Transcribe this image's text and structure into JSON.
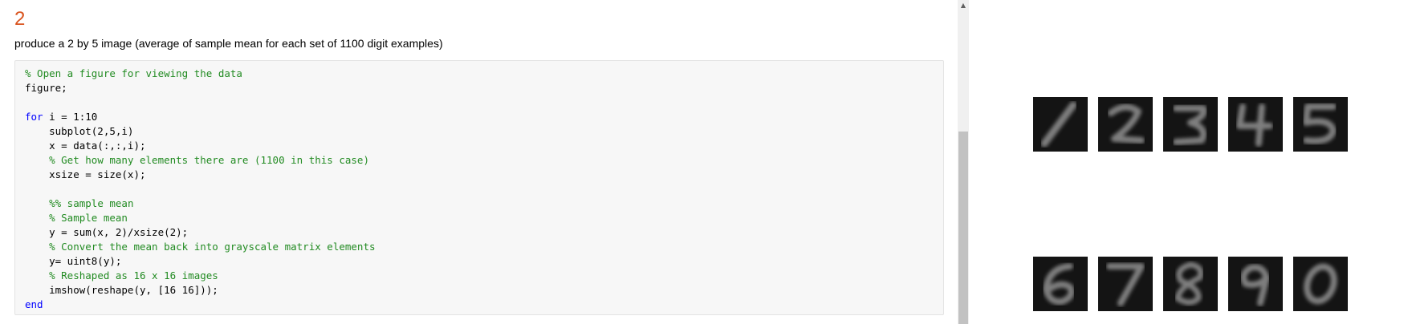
{
  "section": {
    "number": "2",
    "description": "produce a 2 by 5 image (average of sample mean for each set of 1100 digit examples)"
  },
  "code": {
    "lines": [
      [
        {
          "t": "% Open a figure for viewing the data",
          "c": "comment"
        }
      ],
      [
        {
          "t": "figure;",
          "c": "default"
        }
      ],
      [
        {
          "t": "",
          "c": "default"
        }
      ],
      [
        {
          "t": "for",
          "c": "keyword"
        },
        {
          "t": " i = 1:10",
          "c": "default"
        }
      ],
      [
        {
          "t": "    subplot(2,5,i)",
          "c": "default"
        }
      ],
      [
        {
          "t": "    x = data(:,:,i);",
          "c": "default"
        }
      ],
      [
        {
          "t": "    ",
          "c": "default"
        },
        {
          "t": "% Get how many elements there are (1100 in this case)",
          "c": "comment"
        }
      ],
      [
        {
          "t": "    xsize = size(x);",
          "c": "default"
        }
      ],
      [
        {
          "t": "",
          "c": "default"
        }
      ],
      [
        {
          "t": "    ",
          "c": "default"
        },
        {
          "t": "%% sample mean",
          "c": "comment"
        }
      ],
      [
        {
          "t": "    ",
          "c": "default"
        },
        {
          "t": "% Sample mean",
          "c": "comment"
        }
      ],
      [
        {
          "t": "    y = sum(x, 2)/xsize(2);",
          "c": "default"
        }
      ],
      [
        {
          "t": "    ",
          "c": "default"
        },
        {
          "t": "% Convert the mean back into grayscale matrix elements",
          "c": "comment"
        }
      ],
      [
        {
          "t": "    y= uint8(y);",
          "c": "default"
        }
      ],
      [
        {
          "t": "    ",
          "c": "default"
        },
        {
          "t": "% Reshaped as 16 x 16 images",
          "c": "comment"
        }
      ],
      [
        {
          "t": "    imshow(reshape(y, [16 16]));",
          "c": "default"
        }
      ],
      [
        {
          "t": "end",
          "c": "keyword"
        }
      ]
    ]
  },
  "scrollbar": {
    "up_arrow_icon": "triangle-up-icon"
  },
  "figure": {
    "digits": [
      "1",
      "2",
      "3",
      "4",
      "5",
      "6",
      "7",
      "8",
      "9",
      "0"
    ],
    "colors": {
      "cell_background": "#141414",
      "stroke": "#8a8a8a"
    }
  },
  "colors": {
    "section_number": "#d9541e",
    "comment": "#228b22",
    "keyword": "#0000ff",
    "code_background": "#f7f7f7"
  }
}
